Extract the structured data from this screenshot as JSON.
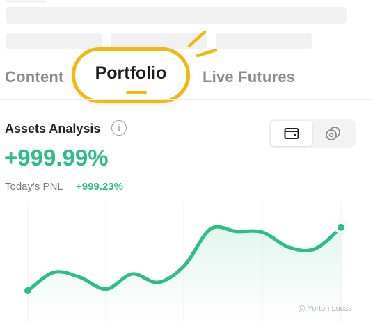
{
  "tabs": {
    "content": "Content",
    "portfolio": "Portfolio",
    "live_futures": "Live Futures"
  },
  "assets": {
    "title": "Assets Analysis",
    "info_symbol": "i",
    "total_change": "+999.99%",
    "todays_pnl_label": "Today's PNL",
    "todays_pnl_value": "+999.23%"
  },
  "view_toggle": {
    "options": [
      "wallet-icon",
      "coins-icon"
    ],
    "selected": "wallet-icon"
  },
  "chart_data": {
    "type": "line",
    "x": [
      0,
      1,
      2,
      3,
      4,
      5,
      6,
      7,
      8,
      9,
      10,
      11,
      12
    ],
    "values": [
      10,
      32,
      26,
      12,
      30,
      20,
      40,
      84,
      81,
      80,
      62,
      60,
      86
    ],
    "ylim": [
      0,
      100
    ],
    "grid": "vertical",
    "color": "#2ebd85"
  },
  "watermark": "@ Yorton Lucas",
  "colors": {
    "accent": "#f0b90b",
    "positive": "#2ebd85"
  }
}
